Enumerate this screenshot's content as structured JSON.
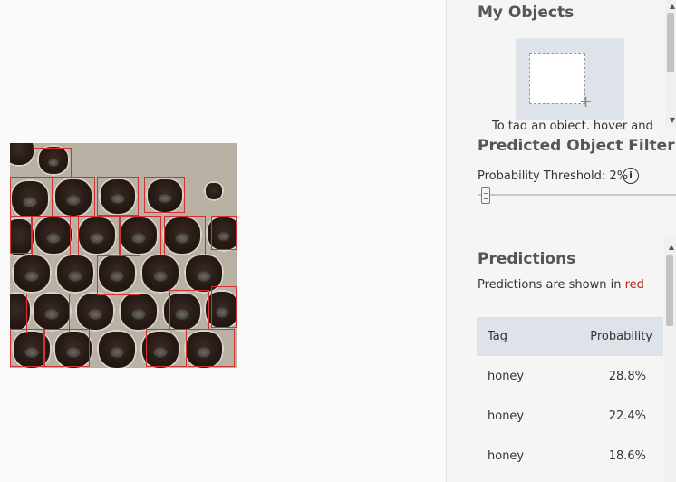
{
  "my_objects": {
    "title": "My Objects",
    "hint_text": "To tag an object, hover and"
  },
  "filter": {
    "title": "Predicted Object Filter",
    "threshold_label": "Probability Threshold: 2%",
    "threshold_value": 2,
    "info_icon": "info-icon"
  },
  "predictions": {
    "title": "Predictions",
    "desc_prefix": "Predictions are shown in ",
    "desc_color_word": "red",
    "columns": {
      "tag": "Tag",
      "probability": "Probability"
    },
    "rows": [
      {
        "tag": "honey",
        "probability": "28.8%"
      },
      {
        "tag": "honey",
        "probability": "22.4%"
      },
      {
        "tag": "honey",
        "probability": "18.6%"
      }
    ]
  },
  "colors": {
    "prediction_box": "#d23232",
    "panel_bg": "#f5f5f5",
    "table_header_bg": "#dde3e8"
  }
}
